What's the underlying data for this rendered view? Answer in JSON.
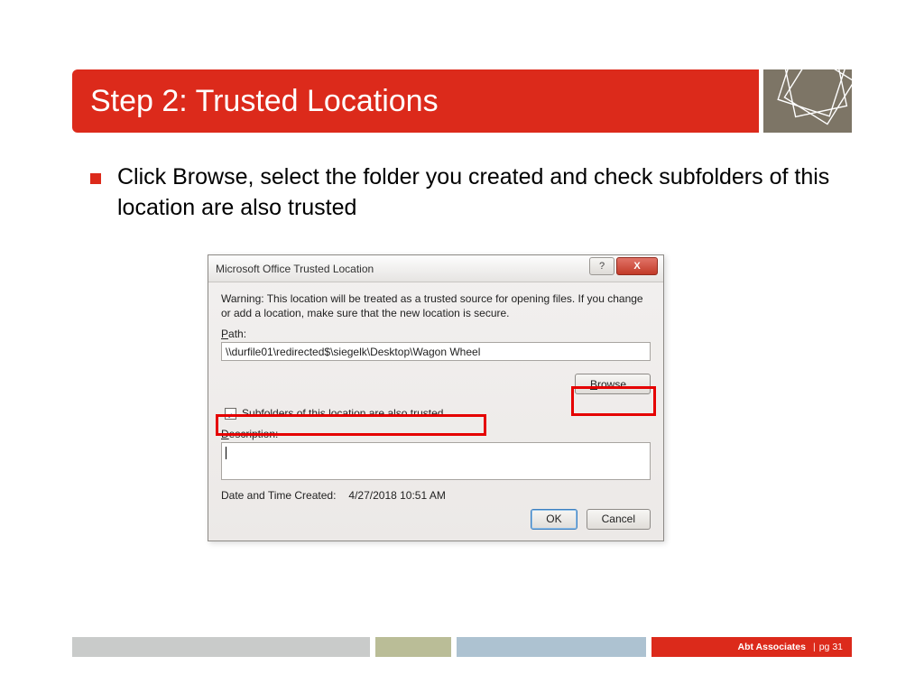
{
  "slide": {
    "title": "Step 2: Trusted Locations",
    "bullet": "Click Browse, select the folder you created and check subfolders of this location are also trusted"
  },
  "dialog": {
    "title": "Microsoft Office Trusted Location",
    "help_glyph": "?",
    "close_glyph": "X",
    "warning": "Warning: This location will be treated as a trusted source for opening files. If you change or add a location, make sure that the new location is secure.",
    "path_label_u": "P",
    "path_label_rest": "ath:",
    "path_value": "\\\\durfile01\\redirected$\\siegelk\\Desktop\\Wagon Wheel",
    "browse_u": "B",
    "browse_rest": "rowse...",
    "subfolders_u": "S",
    "subfolders_rest": "ubfolders of this location are also trusted",
    "subfolders_checked": true,
    "desc_label_u": "D",
    "desc_label_rest": "escription:",
    "desc_value": "",
    "created_label": "Date and Time Created:",
    "created_value": "4/27/2018 10:51 AM",
    "ok_label": "OK",
    "cancel_label": "Cancel"
  },
  "footer": {
    "brand": "Abt Associates",
    "sep": "|",
    "page_label": "pg",
    "page_num": "31"
  }
}
